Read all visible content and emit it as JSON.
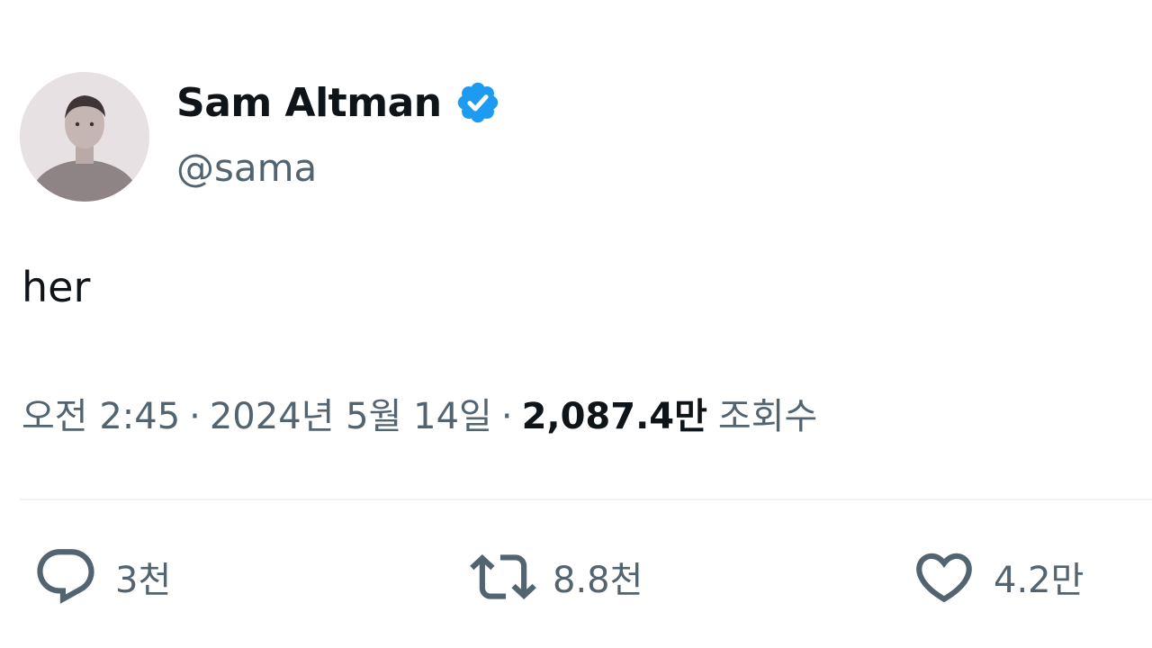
{
  "author": {
    "display_name": "Sam Altman",
    "handle": "@sama",
    "verified_color": "#1d9bf0"
  },
  "tweet": {
    "text": "her"
  },
  "meta": {
    "time": "오전 2:45",
    "separator": "·",
    "date": "2024년 5월 14일",
    "views_count": "2,087.4만",
    "views_label": "조회수"
  },
  "actions": {
    "reply": {
      "icon": "reply-icon",
      "count": "3천"
    },
    "retweet": {
      "icon": "retweet-icon",
      "count": "8.8천"
    },
    "like": {
      "icon": "heart-icon",
      "count": "4.2만"
    }
  },
  "colors": {
    "text_primary": "#0f1419",
    "text_secondary": "#536471",
    "divider": "#eff3f4"
  }
}
